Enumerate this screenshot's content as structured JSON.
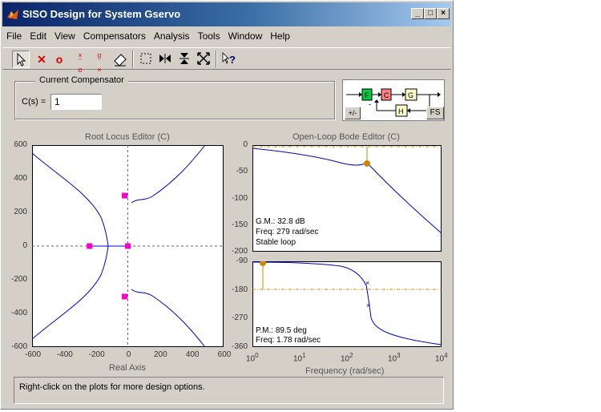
{
  "window": {
    "title": "SISO Design for System Gservo"
  },
  "menu": [
    "File",
    "Edit",
    "View",
    "Compensators",
    "Analysis",
    "Tools",
    "Window",
    "Help"
  ],
  "toolbar_icons": [
    "pointer-icon",
    "add-pole-icon",
    "add-zero-icon",
    "add-lead-icon",
    "add-lag-icon",
    "eraser-icon",
    "zoom-box-icon",
    "zoom-x-icon",
    "zoom-y-icon",
    "zoom-fit-icon",
    "help-icon"
  ],
  "compensator": {
    "legend": "Current Compensator",
    "label": "C(s) =",
    "value": "1"
  },
  "diagram": {
    "blocks": [
      "F",
      "C",
      "G",
      "H"
    ],
    "minus_sign": "-",
    "sign_button": "+/-",
    "fs_button": "FS"
  },
  "root_locus": {
    "title": "Root Locus Editor (C)",
    "xlabel": "Real Axis",
    "xticks": [
      "-600",
      "-400",
      "-200",
      "0",
      "200",
      "400",
      "600"
    ],
    "yticks": [
      "600",
      "400",
      "200",
      "0",
      "-200",
      "-400",
      "-600"
    ],
    "xlim": [
      -600,
      600
    ],
    "ylim": [
      -600,
      600
    ]
  },
  "bode": {
    "title": "Open-Loop Bode Editor (C)",
    "xlabel": "Frequency (rad/sec)",
    "mag_yticks": [
      "0",
      "-50",
      "-100",
      "-150",
      "-200"
    ],
    "phase_yticks": [
      "-90",
      "-180",
      "-270",
      "-360"
    ],
    "xticks_base": [
      "10",
      "10",
      "10",
      "10",
      "10"
    ],
    "xticks_exp": [
      "0",
      "1",
      "2",
      "3",
      "4"
    ],
    "gm_text": "G.M.: 32.8 dB",
    "gm_freq": "Freq: 279 rad/sec",
    "stable": "Stable loop",
    "pm_text": "P.M.: 89.5 deg",
    "pm_freq": "Freq: 1.78 rad/sec"
  },
  "chart_data": [
    {
      "type": "scatter",
      "title": "Root Locus Editor (C)",
      "xlabel": "Real Axis",
      "ylabel": "",
      "xlim": [
        -600,
        600
      ],
      "ylim": [
        -600,
        600
      ],
      "poles": [
        [
          -240,
          0
        ],
        [
          -20,
          300
        ],
        [
          -20,
          -300
        ]
      ],
      "zeros": [],
      "markers": [
        [
          -240,
          0
        ],
        [
          0,
          0
        ],
        [
          -20,
          300
        ],
        [
          -20,
          -300
        ]
      ]
    },
    {
      "type": "line",
      "title": "Open-Loop Bode Editor (C)",
      "xlabel": "Frequency (rad/sec)",
      "xscale": "log",
      "xlim": [
        1,
        10000
      ],
      "magnitude_ylim": [
        -200,
        0
      ],
      "phase_ylim": [
        -360,
        -90
      ],
      "gain_margin_db": 32.8,
      "gain_margin_freq": 279,
      "phase_margin_deg": 89.5,
      "phase_margin_freq": 1.78
    }
  ],
  "status_text": "Right-click on the plots for more design options.",
  "colors": {
    "curve": "#0000cc",
    "pole_marker": "#ff00cc",
    "margin_marker": "#cc8800",
    "title_bar": "#0a246a"
  }
}
